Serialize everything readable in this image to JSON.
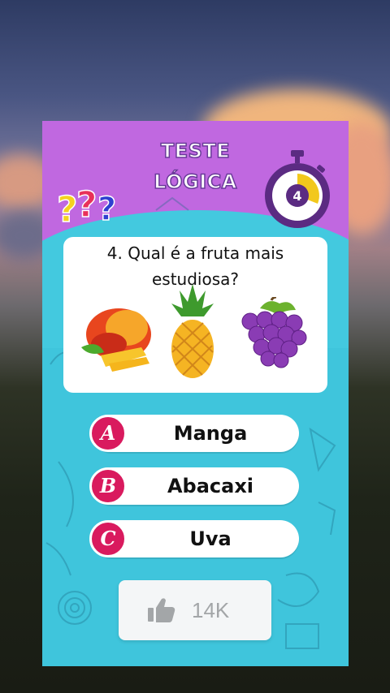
{
  "quiz": {
    "title_line1": "TESTE",
    "title_line2": "LÓGICA",
    "timer_value": "4",
    "question_line1": "4. Qual é a fruta mais",
    "question_line2": "estudiosa?",
    "fruits": [
      "mango-icon",
      "pineapple-icon",
      "grapes-icon"
    ],
    "answers": [
      {
        "letter": "A",
        "label": "Manga"
      },
      {
        "letter": "B",
        "label": "Abacaxi"
      },
      {
        "letter": "C",
        "label": "Uva"
      }
    ],
    "likes": "14K"
  },
  "colors": {
    "card_top": "#c068e0",
    "card_body": "#3fc5dc",
    "badge": "#d91a5e",
    "timer_ring": "#5b2b82",
    "timer_fill": "#f2c81c"
  }
}
